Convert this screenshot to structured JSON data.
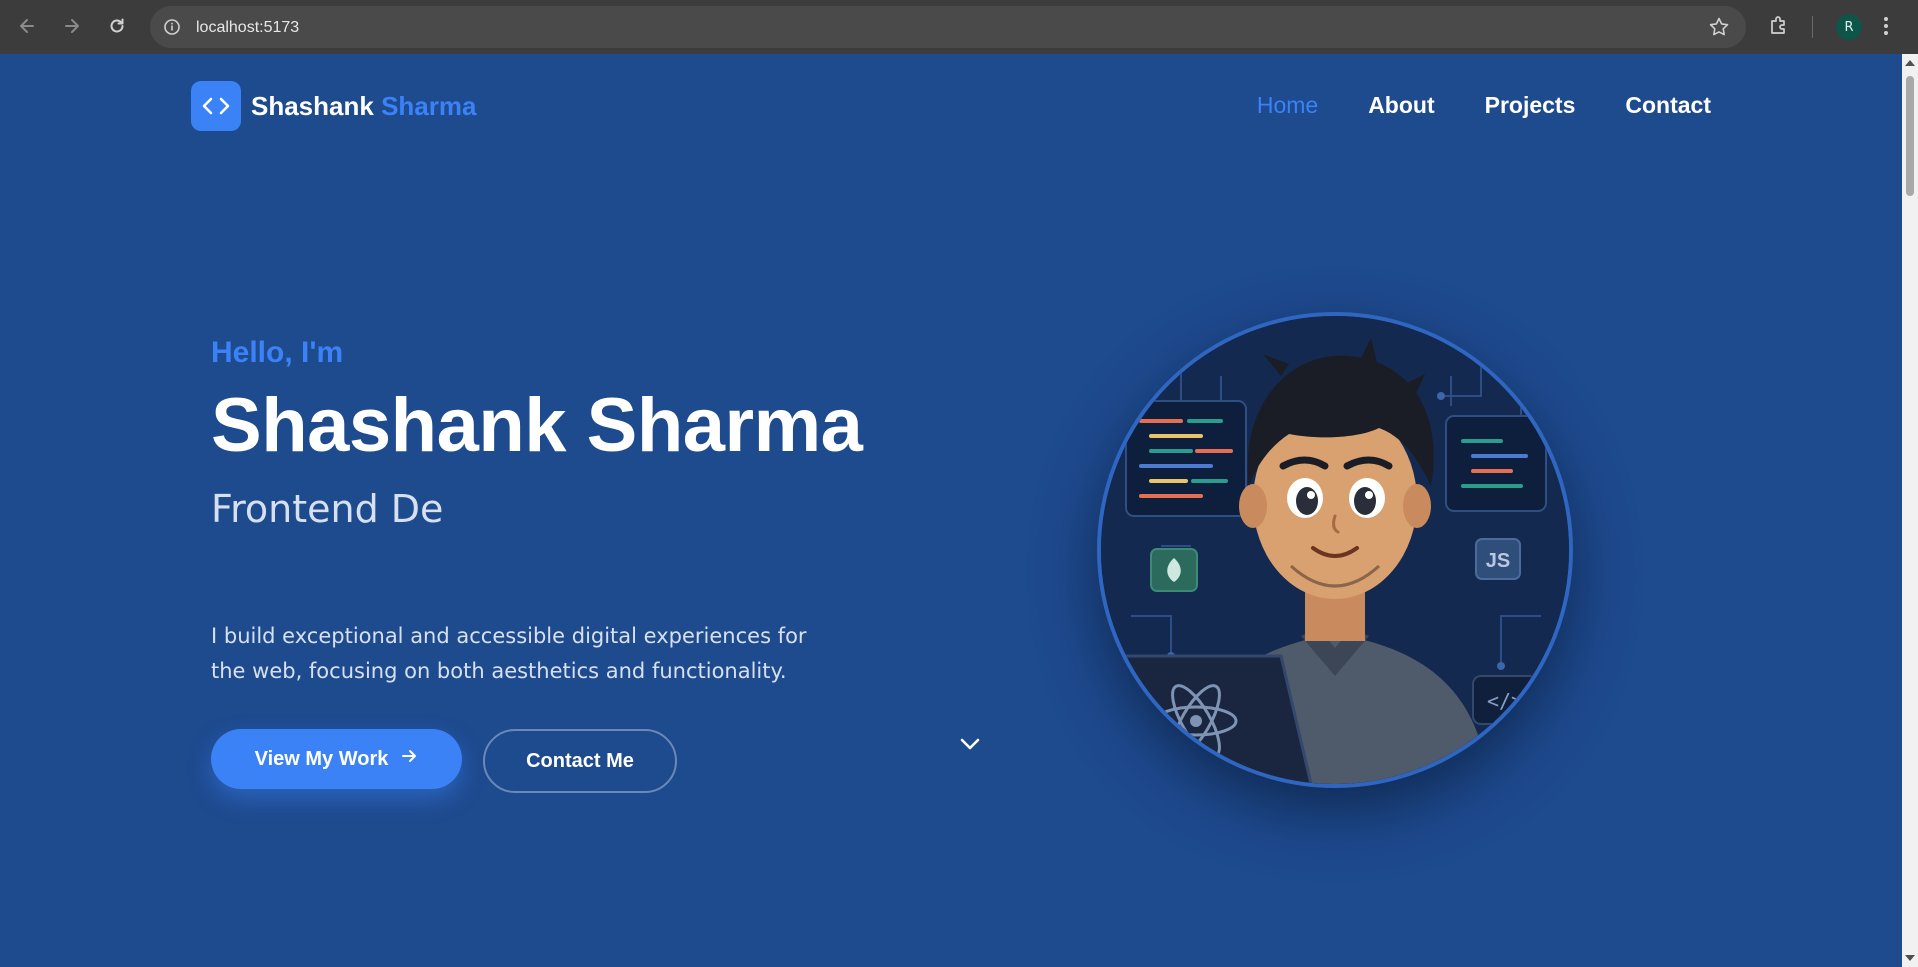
{
  "browser": {
    "url": "localhost:5173",
    "profile_initial": "R"
  },
  "header": {
    "logo_first": "Shashank",
    "logo_second": "Sharma",
    "nav": [
      {
        "label": "Home",
        "active": true
      },
      {
        "label": "About",
        "active": false
      },
      {
        "label": "Projects",
        "active": false
      },
      {
        "label": "Contact",
        "active": false
      }
    ]
  },
  "hero": {
    "greeting": "Hello, I'm",
    "name": "Shashank Sharma",
    "role": "Frontend De",
    "description": "I build exceptional and accessible digital experiences for the web, focusing on both aesthetics and functionality.",
    "primary_button": "View My Work",
    "secondary_button": "Contact Me"
  },
  "colors": {
    "page_bg": "#1e4a8e",
    "accent": "#3b82f6",
    "chrome_bg": "#3c3c3c"
  },
  "icons": {
    "logo": "code-brackets-icon",
    "primary_button": "arrow-right-icon",
    "scroll": "chevron-down-icon"
  }
}
